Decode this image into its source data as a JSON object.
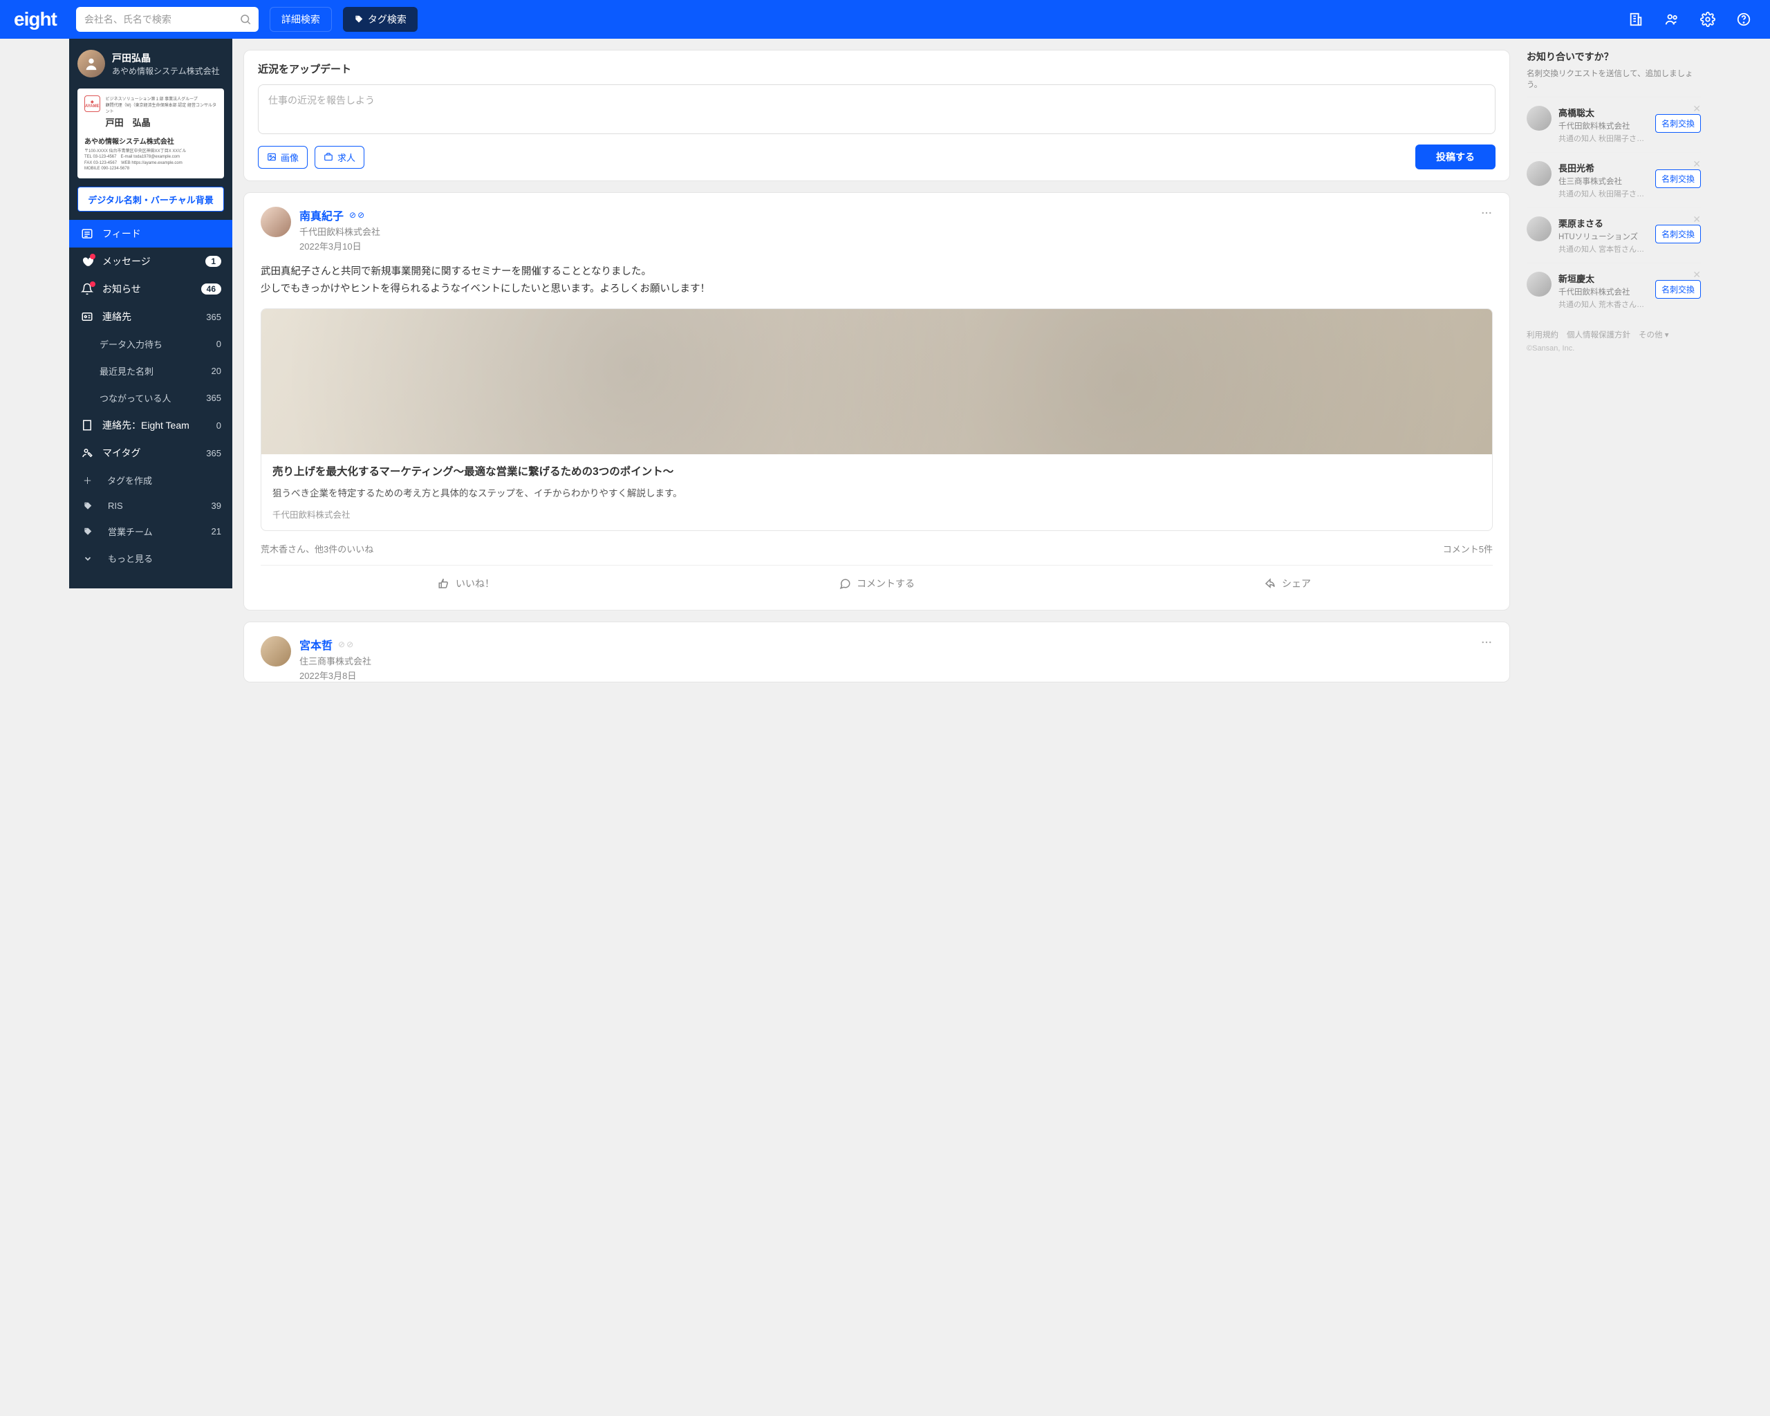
{
  "header": {
    "logo": "eight",
    "search_placeholder": "会社名、氏名で検索",
    "adv_search": "詳細検索",
    "tag_search": "タグ検索"
  },
  "profile": {
    "name": "戸田弘晶",
    "company": "あやめ情報システム株式会社",
    "digital_btn": "デジタル名刺・バーチャル背景"
  },
  "card": {
    "dept": "ビジネスソリューション第１部 事業法人グループ",
    "role": "顧問代理（M)（東京経済生命保険本部 認定 経営コンサルタント",
    "name": "戸田　弘晶",
    "company": "あやめ情報システム株式会社",
    "addr": "〒100-XXXX 仙台市青葉区中央区神田XX丁目X XXビル",
    "tel": "TEL 03-123-4567",
    "fax": "FAX 03-123-4567",
    "mobile": "MOBILE 090-1234-5678",
    "email": "E-mail toda1978@example.com",
    "web": "WEB https://ayame.example.com"
  },
  "nav": {
    "feed": "フィード",
    "messages": "メッセージ",
    "messages_count": "1",
    "news": "お知らせ",
    "news_count": "46",
    "contacts": "連絡先",
    "contacts_count": "365",
    "pending": "データ入力待ち",
    "pending_count": "0",
    "recent": "最近見た名刺",
    "recent_count": "20",
    "connected": "つながっている人",
    "connected_count": "365",
    "team": "連絡先：Eight Team",
    "team_count": "0",
    "mytag": "マイタグ",
    "mytag_count": "365",
    "createtag": "タグを作成",
    "ris": "RIS",
    "ris_count": "39",
    "sales": "営業チーム",
    "sales_count": "21",
    "more": "もっと見る"
  },
  "composer": {
    "title": "近況をアップデート",
    "placeholder": "仕事の近況を報告しよう",
    "image": "画像",
    "job": "求人",
    "post": "投稿する"
  },
  "feed1": {
    "name": "南真紀子",
    "company": "千代田飲料株式会社",
    "date": "2022年3月10日",
    "body1": "武田真紀子さんと共同で新規事業開発に関するセミナーを開催することとなりました。",
    "body2": "少しでもきっかけやヒントを得られるようなイベントにしたいと思います。よろしくお願いします！",
    "link_title": "売り上げを最大化するマーケティング〜最適な営業に繋げるための3つのポイント〜",
    "link_desc": "狙うべき企業を特定するための考え方と具体的なステップを、イチからわかりやすく解説します。",
    "link_src": "千代田飲料株式会社",
    "likes": "荒木香さん、他3件のいいね",
    "comments": "コメント5件",
    "act_like": "いいね！",
    "act_comment": "コメントする",
    "act_share": "シェア"
  },
  "feed2": {
    "name": "宮本哲",
    "company": "住三商事株式会社",
    "date": "2022年3月8日"
  },
  "right": {
    "title": "お知り合いですか？",
    "sub": "名刺交換リクエストを送信して、追加しましょう。",
    "exchange": "名刺交換",
    "s": [
      {
        "name": "高橋聡太",
        "co": "千代田飲料株式会社",
        "mutual": "共通の知人 秋田陽子さん、…"
      },
      {
        "name": "長田光希",
        "co": "住三商事株式会社",
        "mutual": "共通の知人 秋田陽子さん、他…"
      },
      {
        "name": "栗原まさる",
        "co": "HTUソリューションズ",
        "mutual": "共通の知人 宮本哲さん、他…"
      },
      {
        "name": "新垣慶太",
        "co": "千代田飲料株式会社",
        "mutual": "共通の知人 荒木香さん、他…"
      }
    ],
    "terms": "利用規約",
    "privacy": "個人情報保護方針",
    "other": "その他 ▾",
    "copyright": "©Sansan, Inc."
  }
}
